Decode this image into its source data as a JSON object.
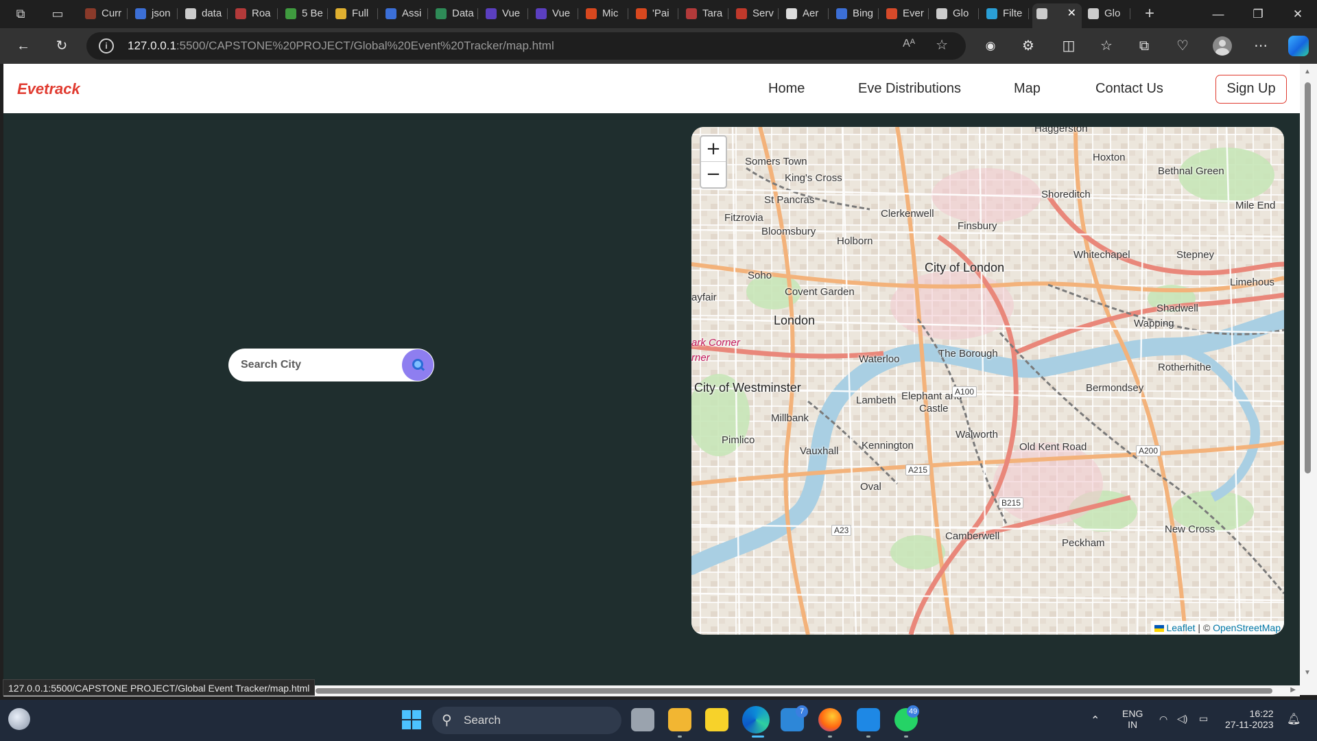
{
  "browser": {
    "tabs": [
      {
        "label": "Curr",
        "favicon_color": "#8a3a2a"
      },
      {
        "label": "json",
        "favicon_color": "#3c6fd6"
      },
      {
        "label": "data",
        "favicon_color": "#cccccc"
      },
      {
        "label": "Roa",
        "favicon_color": "#b33a3a"
      },
      {
        "label": "5 Be",
        "favicon_color": "#3f9b3f"
      },
      {
        "label": "Full",
        "favicon_color": "#e0b030"
      },
      {
        "label": "Assi",
        "favicon_color": "#3b6fd8"
      },
      {
        "label": "Data",
        "favicon_color": "#2e8b57"
      },
      {
        "label": "Vue",
        "favicon_color": "#5b3fc0"
      },
      {
        "label": "Vue",
        "favicon_color": "#5b3fc0"
      },
      {
        "label": "Mic",
        "favicon_color": "#d8481f"
      },
      {
        "label": "'Pai",
        "favicon_color": "#d8481f"
      },
      {
        "label": "Tara",
        "favicon_color": "#b33a3a"
      },
      {
        "label": "Serv",
        "favicon_color": "#c0392b"
      },
      {
        "label": "Aer",
        "favicon_color": "#dddddd"
      },
      {
        "label": "Bing",
        "favicon_color": "#3c6fd6"
      },
      {
        "label": "Ever",
        "favicon_color": "#d64a2a"
      },
      {
        "label": "Glo",
        "favicon_color": "#cccccc"
      },
      {
        "label": "Filte",
        "favicon_color": "#2a9fd6"
      },
      {
        "label": "",
        "favicon_color": "#cccccc",
        "active": true
      },
      {
        "label": "Glo",
        "favicon_color": "#cccccc"
      }
    ],
    "new_tab_label": "+",
    "close_tab_label": "✕",
    "url_host": "127.0.0.1",
    "url_rest": ":5500/CAPSTONE%20PROJECT/Global%20Event%20Tracker/map.html",
    "read_aloud_label": "Aᴬ",
    "status_url": "127.0.0.1:5500/CAPSTONE PROJECT/Global Event Tracker/map.html"
  },
  "site": {
    "logo": "Evetrack",
    "nav": {
      "home": "Home",
      "distributions": "Eve Distributions",
      "map": "Map",
      "contact": "Contact Us",
      "signup": "Sign Up"
    },
    "search": {
      "placeholder": "Search City"
    }
  },
  "map": {
    "zoom_in": "+",
    "zoom_out": "−",
    "attribution": {
      "leaflet": "Leaflet",
      "separator": " | © ",
      "osm": "OpenStreetMap"
    },
    "labels": [
      {
        "text": "Haggerston",
        "kind": "normal"
      },
      {
        "text": "Somers Town",
        "kind": "normal"
      },
      {
        "text": "Hoxton",
        "kind": "normal"
      },
      {
        "text": "Bethnal Green",
        "kind": "normal"
      },
      {
        "text": "King's Cross",
        "kind": "normal"
      },
      {
        "text": "St Pancras",
        "kind": "normal"
      },
      {
        "text": "Shoreditch",
        "kind": "normal"
      },
      {
        "text": "Mile End",
        "kind": "normal"
      },
      {
        "text": "Clerkenwell",
        "kind": "normal"
      },
      {
        "text": "Fitzrovia",
        "kind": "normal"
      },
      {
        "text": "Finsbury",
        "kind": "normal"
      },
      {
        "text": "Bloomsbury",
        "kind": "normal"
      },
      {
        "text": "Holborn",
        "kind": "normal"
      },
      {
        "text": "Whitechapel",
        "kind": "normal"
      },
      {
        "text": "Stepney",
        "kind": "normal"
      },
      {
        "text": "City of London",
        "kind": "big"
      },
      {
        "text": "Soho",
        "kind": "normal"
      },
      {
        "text": "Limehous",
        "kind": "normal"
      },
      {
        "text": "Covent Garden",
        "kind": "normal"
      },
      {
        "text": "ayfair",
        "kind": "normal"
      },
      {
        "text": "Shadwell",
        "kind": "normal"
      },
      {
        "text": "London",
        "kind": "big"
      },
      {
        "text": "Wapping",
        "kind": "normal"
      },
      {
        "text": "ark Corner",
        "kind": "pink"
      },
      {
        "text": "rner",
        "kind": "pink"
      },
      {
        "text": "The Borough",
        "kind": "normal"
      },
      {
        "text": "Waterloo",
        "kind": "normal"
      },
      {
        "text": "Rotherhithe",
        "kind": "normal"
      },
      {
        "text": "City of Westminster",
        "kind": "big"
      },
      {
        "text": "Bermondsey",
        "kind": "normal"
      },
      {
        "text": "Lambeth",
        "kind": "normal"
      },
      {
        "text": "Elephant and",
        "kind": "normal"
      },
      {
        "text": "Castle",
        "kind": "normal"
      },
      {
        "text": "Millbank",
        "kind": "normal"
      },
      {
        "text": "Walworth",
        "kind": "normal"
      },
      {
        "text": "Pimlico",
        "kind": "normal"
      },
      {
        "text": "Kennington",
        "kind": "normal"
      },
      {
        "text": "Old Kent Road",
        "kind": "normal"
      },
      {
        "text": "Vauxhall",
        "kind": "normal"
      },
      {
        "text": "Oval",
        "kind": "normal"
      },
      {
        "text": "New Cross",
        "kind": "normal"
      },
      {
        "text": "Camberwell",
        "kind": "normal"
      },
      {
        "text": "Peckham",
        "kind": "normal"
      }
    ],
    "road_shields": [
      "A100",
      "A200",
      "A215",
      "B215",
      "A23"
    ]
  },
  "taskbar": {
    "search_label": "Search",
    "vscode_badge": "7",
    "whatsapp_badge": "49",
    "language": "ENG",
    "region": "IN",
    "time": "16:22",
    "date": "27-11-2023"
  }
}
